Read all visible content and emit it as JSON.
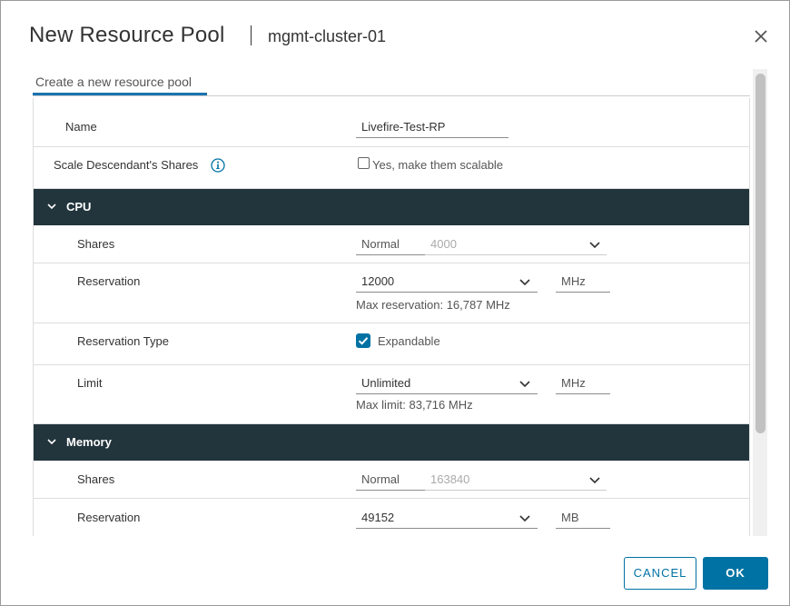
{
  "dialog": {
    "title": "New Resource Pool",
    "subtitle": "mgmt-cluster-01",
    "close_icon": "close-icon"
  },
  "tab": {
    "label": "Create a new resource pool"
  },
  "form": {
    "name": {
      "label": "Name",
      "value": "Livefire-Test-RP"
    },
    "scale_shares": {
      "label": "Scale Descendant's Shares",
      "info_icon": "info-icon",
      "checkbox_label": "Yes, make them scalable",
      "checked": false
    },
    "cpu": {
      "section_label": "CPU",
      "shares": {
        "label": "Shares",
        "level": "Normal",
        "value": "4000"
      },
      "reservation": {
        "label": "Reservation",
        "value": "12000",
        "unit": "MHz",
        "hint": "Max reservation: 16,787 MHz"
      },
      "reservation_type": {
        "label": "Reservation Type",
        "checkbox_label": "Expandable",
        "checked": true
      },
      "limit": {
        "label": "Limit",
        "value": "Unlimited",
        "unit": "MHz",
        "hint": "Max limit: 83,716 MHz"
      }
    },
    "memory": {
      "section_label": "Memory",
      "shares": {
        "label": "Shares",
        "level": "Normal",
        "value": "163840"
      },
      "reservation": {
        "label": "Reservation",
        "value": "49152",
        "unit": "MB"
      }
    }
  },
  "footer": {
    "cancel_label": "CANCEL",
    "ok_label": "OK"
  },
  "colors": {
    "primary": "#0072a3",
    "section_bg": "#22343c",
    "tab_accent": "#1b73b0"
  }
}
